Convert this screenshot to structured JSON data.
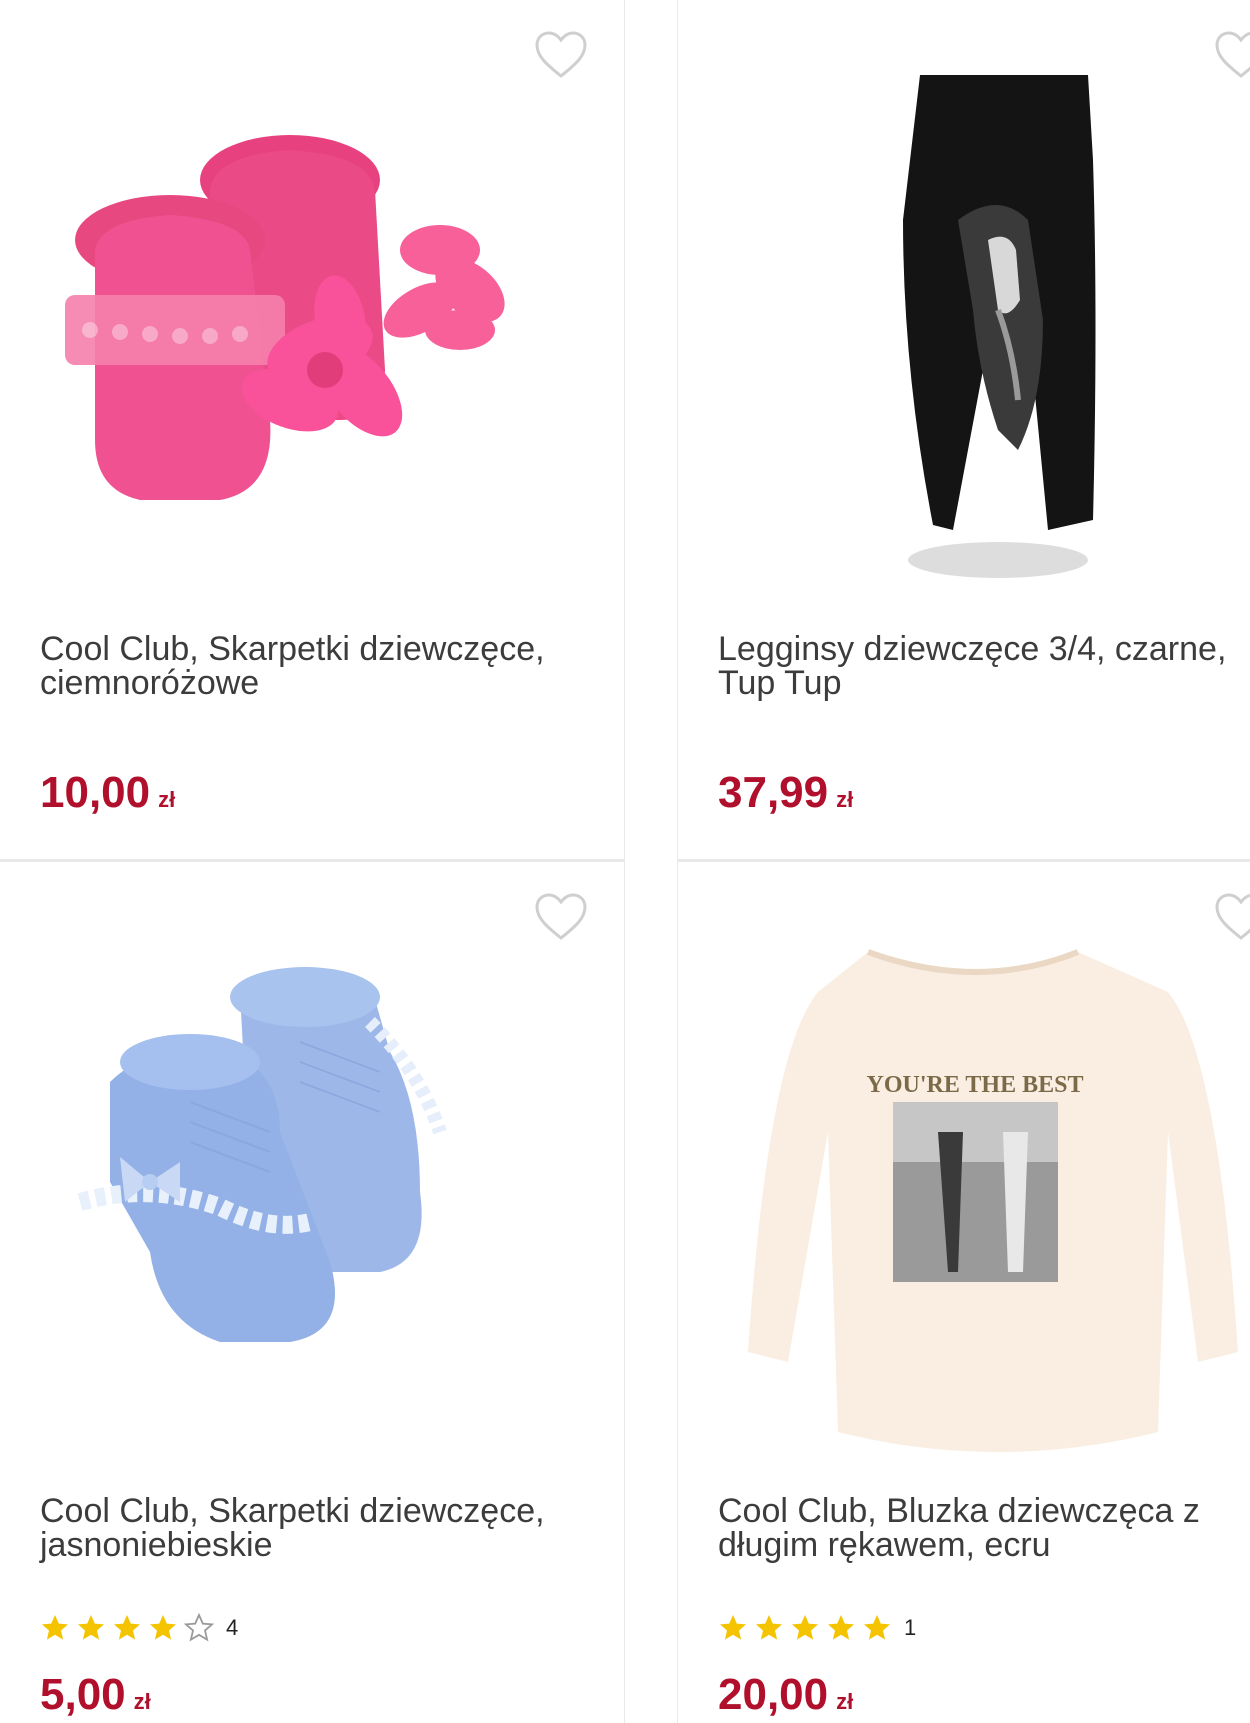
{
  "products": [
    {
      "title": "Cool Club, Skarpetki dziewczęce, ciemnoróżowe",
      "price": "10,00",
      "currency": "zł",
      "image_icon": "pink-baby-socks-image",
      "colors": {
        "main": "#f2508e",
        "accent": "#f86aa0"
      }
    },
    {
      "title": "Legginsy dziewczęce 3/4, czarne, Tup Tup",
      "price": "37,99",
      "currency": "zł",
      "image_icon": "black-leggings-image"
    },
    {
      "title": "Cool Club, Skarpetki dziewczęce, jasnoniebieskie",
      "price": "5,00",
      "currency": "zł",
      "rating": 4,
      "rating_max": 5,
      "rating_count": "4",
      "image_icon": "blue-baby-socks-image"
    },
    {
      "title": "Cool Club, Bluzka dziewczęca z długim rękawem, ecru",
      "price": "20,00",
      "currency": "zł",
      "rating": 5,
      "rating_max": 5,
      "rating_count": "1",
      "image_icon": "ecru-long-sleeve-shirt-image",
      "print_text": "YOU'RE THE BEST"
    }
  ],
  "colors": {
    "price": "#b0102b",
    "star": "#f5c400",
    "heart_outline": "#cfcfcf",
    "divider": "#e9e9e9"
  }
}
